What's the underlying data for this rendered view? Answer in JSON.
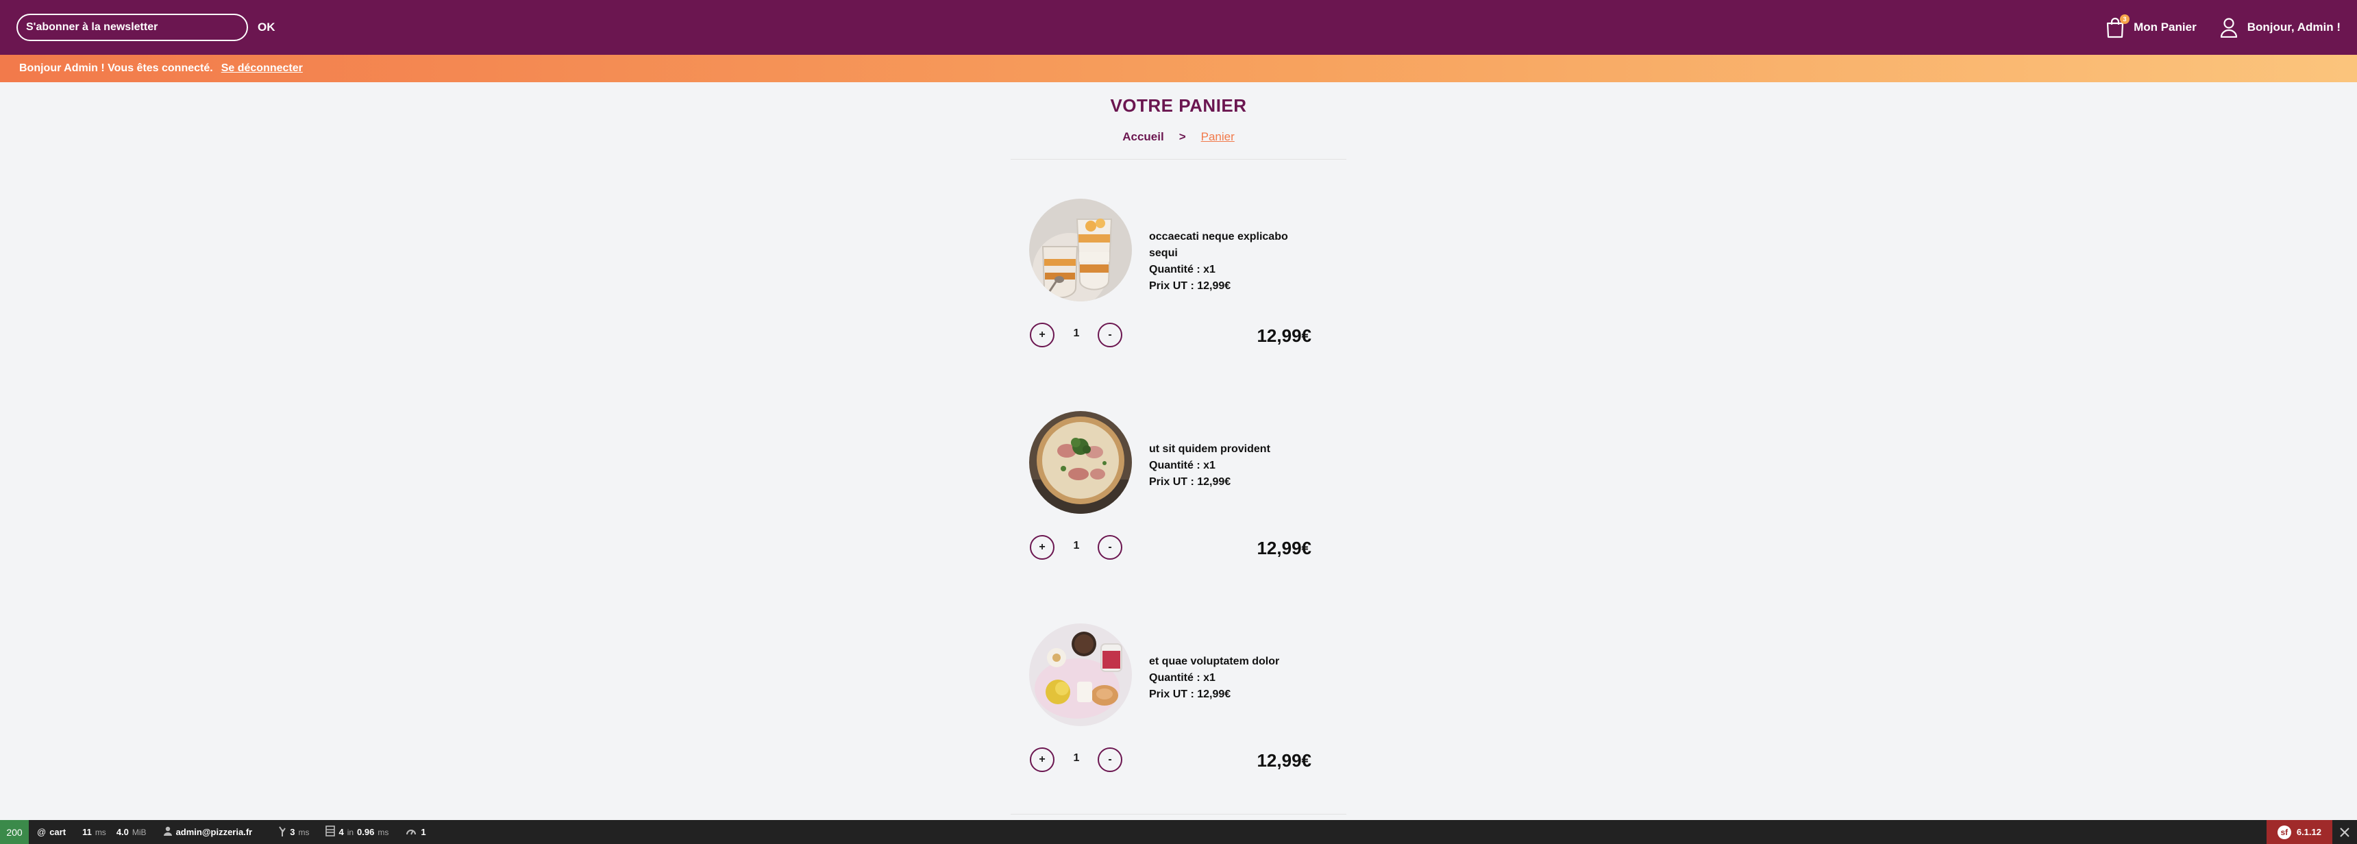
{
  "header": {
    "newsletter_placeholder": "S'abonner à la newsletter",
    "ok_label": "OK",
    "cart_label": "Mon Panier",
    "cart_count": "3",
    "account_label": "Bonjour, Admin !"
  },
  "notice": {
    "message": "Bonjour Admin ! Vous êtes connecté.",
    "logout_label": "Se déconnecter"
  },
  "page": {
    "title": "VOTRE PANIER",
    "breadcrumb": {
      "home": "Accueil",
      "separator": ">",
      "current": "Panier"
    }
  },
  "cart": {
    "items": [
      {
        "name": "occaecati neque explicabo sequi",
        "quantity_text": "Quantité : x1",
        "unit_price_text": "Prix UT : 12,99€",
        "quantity": "1",
        "total": "12,99€",
        "plus_label": "+",
        "minus_label": "-",
        "image": "dessert-verrine-image"
      },
      {
        "name": "ut sit quidem provident",
        "quantity_text": "Quantité : x1",
        "unit_price_text": "Prix UT : 12,99€",
        "quantity": "1",
        "total": "12,99€",
        "plus_label": "+",
        "minus_label": "-",
        "image": "pizza-image"
      },
      {
        "name": "et quae voluptatem dolor",
        "quantity_text": "Quantité : x1",
        "unit_price_text": "Prix UT : 12,99€",
        "quantity": "1",
        "total": "12,99€",
        "plus_label": "+",
        "minus_label": "-",
        "image": "breakfast-plate-image"
      }
    ]
  },
  "debug_toolbar": {
    "status": "200",
    "route": "cart",
    "time_value": "11",
    "time_unit": "ms",
    "memory_value": "4.0",
    "memory_unit": "MiB",
    "user": "admin@pizzeria.fr",
    "twig_value": "3",
    "twig_unit": "ms",
    "db_queries": "4",
    "db_in": "in",
    "db_time": "0.96",
    "db_unit": "ms",
    "cache_count": "1",
    "version": "6.1.12"
  },
  "colors": {
    "brand_purple": "#6b1650",
    "accent_orange": "#f27a4b",
    "background": "#f3f4f6"
  }
}
